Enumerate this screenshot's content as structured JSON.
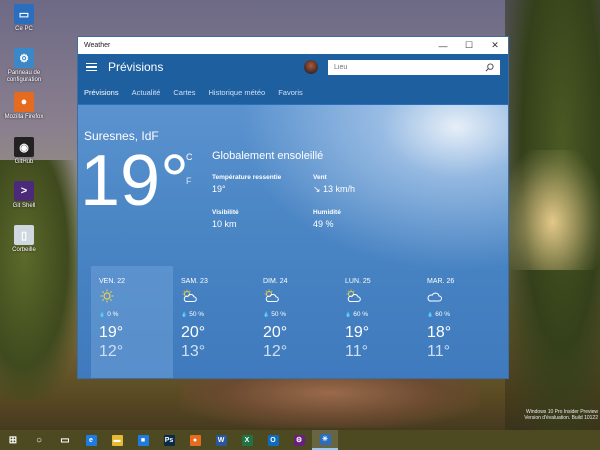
{
  "desktop": {
    "icons": [
      {
        "label": "Ce PC",
        "color": "#2a6fbf",
        "glyph": "▭"
      },
      {
        "label": "Panneau de configuration",
        "color": "#3a88c8",
        "glyph": "⚙"
      },
      {
        "label": "Mozilla Firefox",
        "color": "#e66b1f",
        "glyph": "●"
      },
      {
        "label": "GitHub",
        "color": "#222222",
        "glyph": "◉"
      },
      {
        "label": "Git Shell",
        "color": "#4b2a7a",
        "glyph": ">"
      },
      {
        "label": "Corbeille",
        "color": "#cfd8e0",
        "glyph": "▯"
      }
    ],
    "watermark_line1": "Windows 10 Pro Insider Preview",
    "watermark_line2": "Version d'évaluation. Build 10122"
  },
  "window": {
    "title": "Weather",
    "minimize": "—",
    "maximize": "☐",
    "close": "✕"
  },
  "appbar": {
    "title": "Prévisions",
    "search_placeholder": "Lieu"
  },
  "tabs": [
    {
      "label": "Prévisions",
      "active": true
    },
    {
      "label": "Actualité",
      "active": false
    },
    {
      "label": "Cartes",
      "active": false
    },
    {
      "label": "Historique météo",
      "active": false
    },
    {
      "label": "Favoris",
      "active": false
    }
  ],
  "current": {
    "location": "Suresnes, IdF",
    "temperature": "19°",
    "unit_c": "C",
    "unit_f": "F",
    "condition": "Globalement ensoleillé",
    "feels_like_label": "Température ressentie",
    "feels_like_value": "19°",
    "wind_label": "Vent",
    "wind_value": "↘ 13 km/h",
    "visibility_label": "Visibilité",
    "visibility_value": "10 km",
    "humidity_label": "Humidité",
    "humidity_value": "49 %"
  },
  "forecast": [
    {
      "day": "VEN. 22",
      "icon": "sun-icon",
      "precip": "0 %",
      "high": "19°",
      "low": "12°"
    },
    {
      "day": "SAM. 23",
      "icon": "partly-cloudy-icon",
      "precip": "50 %",
      "high": "20°",
      "low": "13°"
    },
    {
      "day": "DIM. 24",
      "icon": "partly-cloudy-icon",
      "precip": "50 %",
      "high": "20°",
      "low": "12°"
    },
    {
      "day": "LUN. 25",
      "icon": "partly-cloudy-icon",
      "precip": "60 %",
      "high": "19°",
      "low": "11°"
    },
    {
      "day": "MAR. 26",
      "icon": "cloudy-icon",
      "precip": "60 %",
      "high": "18°",
      "low": "11°"
    }
  ],
  "taskbar": [
    {
      "name": "start-button",
      "glyph": "⊞",
      "color": "#ffffff"
    },
    {
      "name": "search-button",
      "glyph": "○",
      "color": "#ffffff"
    },
    {
      "name": "task-view-button",
      "glyph": "▭",
      "color": "#ffffff"
    },
    {
      "name": "edge-taskbar-icon",
      "glyph": "e",
      "color": "#1e7be0"
    },
    {
      "name": "explorer-taskbar-icon",
      "glyph": "▬",
      "color": "#e8b933"
    },
    {
      "name": "store-taskbar-icon",
      "glyph": "■",
      "color": "#1e7be0"
    },
    {
      "name": "photoshop-taskbar-icon",
      "glyph": "Ps",
      "color": "#0b2a4a"
    },
    {
      "name": "firefox-taskbar-icon",
      "glyph": "●",
      "color": "#e66b1f"
    },
    {
      "name": "word-taskbar-icon",
      "glyph": "W",
      "color": "#2b579a"
    },
    {
      "name": "excel-taskbar-icon",
      "glyph": "X",
      "color": "#217346"
    },
    {
      "name": "outlook-taskbar-icon",
      "glyph": "O",
      "color": "#0f6cbd"
    },
    {
      "name": "vs-taskbar-icon",
      "glyph": "⚙",
      "color": "#68217a"
    },
    {
      "name": "weather-taskbar-icon",
      "glyph": "☀",
      "color": "#2a6fbf"
    }
  ]
}
